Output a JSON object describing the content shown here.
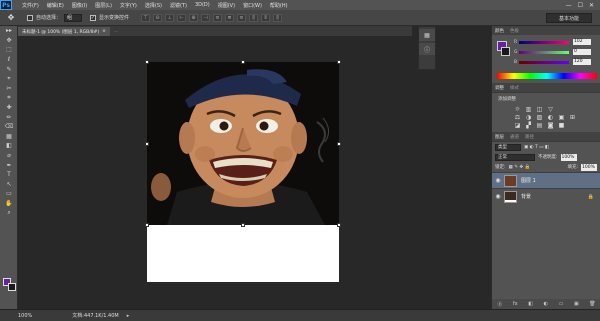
{
  "app": {
    "logo": "Ps"
  },
  "menu": {
    "items": [
      "文件(F)",
      "编辑(E)",
      "图像(I)",
      "图层(L)",
      "文字(Y)",
      "选择(S)",
      "滤镜(T)",
      "3D(D)",
      "视图(V)",
      "窗口(W)",
      "帮助(H)"
    ],
    "minimize": "—",
    "maximize": "☐",
    "close": "✕"
  },
  "options": {
    "tool_icon": "✥",
    "auto_select_label": "自动选择：",
    "auto_select_value": "组",
    "show_transform_label": "显示变换控件",
    "workspace": "基本功能"
  },
  "tabs": [
    {
      "label": "未标题-1 @ 100% (图层 1, RGB/8#)",
      "close": "×",
      "active": true
    },
    {
      "label": "...",
      "close": "",
      "active": false
    }
  ],
  "toolbar": {
    "tools": [
      "▸▸",
      "✥",
      "⬚",
      "ℓ",
      "✎",
      "⌖",
      "✂",
      "⌗",
      "✚",
      "✏",
      "⌫",
      "▦",
      "◧",
      "⌀",
      "✒",
      "T",
      "↖",
      "▭",
      "✋",
      "⌕"
    ]
  },
  "colors": {
    "foreground": "#6a1fa0",
    "background": "#1a1a1a",
    "accent_selected_layer": "#5e6f86"
  },
  "color_panel": {
    "tabs": [
      "颜色",
      "色板"
    ],
    "r": {
      "label": "R",
      "value": "102"
    },
    "g": {
      "label": "G",
      "value": "0"
    },
    "b": {
      "label": "B",
      "value": "120"
    }
  },
  "adjustments_panel": {
    "tabs": [
      "调整",
      "样式"
    ],
    "title": "添加调整",
    "row1": [
      "☼",
      "▥",
      "◫",
      "▽"
    ],
    "row2": [
      "⚖",
      "◑",
      "▨",
      "◐",
      "▣",
      "⊞"
    ],
    "row3": [
      "◪",
      "▞",
      "▤",
      "◙",
      "■"
    ]
  },
  "layers_panel": {
    "tabs": [
      "图层",
      "通道",
      "路径"
    ],
    "filter": "类型",
    "blend_mode": "正常",
    "opacity_label": "不透明度:",
    "opacity_value": "100%",
    "lock_label": "锁定:",
    "fill_label": "填充:",
    "fill_value": "100%",
    "layers": [
      {
        "name": "图层 1",
        "selected": true,
        "visible": true,
        "locked": false
      },
      {
        "name": "背景",
        "selected": false,
        "visible": true,
        "locked": true
      }
    ],
    "bottom_icons": [
      "ⓖ",
      "fx",
      "◧",
      "◐",
      "▭",
      "▣",
      "🗑"
    ]
  },
  "status": {
    "zoom": "100%",
    "doc_size": "文档:447.1K/1.40M",
    "arrow": "▸"
  }
}
